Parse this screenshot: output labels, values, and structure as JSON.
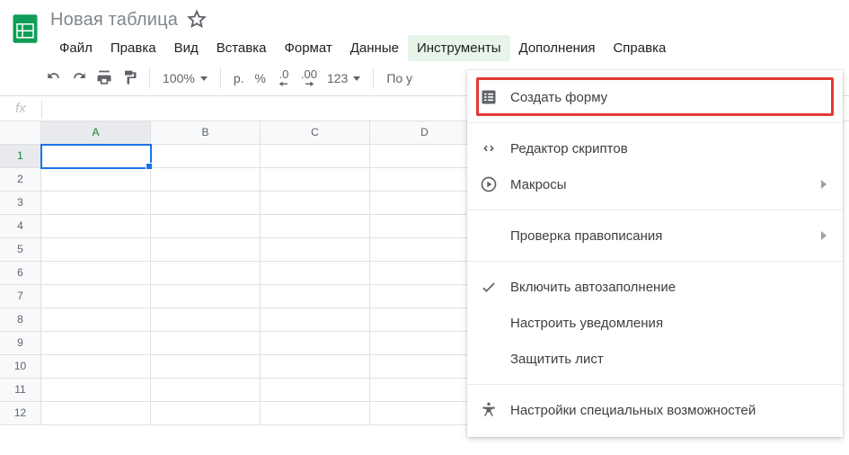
{
  "title": {
    "doc_name": "Новая таблица"
  },
  "menubar": {
    "items": [
      "Файл",
      "Правка",
      "Вид",
      "Вставка",
      "Формат",
      "Данные",
      "Инструменты",
      "Дополнения",
      "Справка"
    ],
    "active_index": 6
  },
  "toolbar": {
    "zoom": "100%",
    "currency_sign": "р.",
    "percent": "%",
    "dec_less": ".0",
    "dec_more": ".00",
    "format_123": "123",
    "font_truncated": "По у"
  },
  "formula_bar": {
    "label": "fx",
    "value": ""
  },
  "sheet": {
    "columns": [
      "A",
      "B",
      "C",
      "D"
    ],
    "selected_col_index": 0,
    "rows": [
      1,
      2,
      3,
      4,
      5,
      6,
      7,
      8,
      9,
      10,
      11,
      12
    ],
    "selected_row_index": 0
  },
  "dropdown": {
    "items": [
      {
        "icon": "form-icon",
        "label": "Создать форму",
        "submenu": false,
        "highlighted": true
      },
      {
        "sep": true
      },
      {
        "icon": "code-icon",
        "label": "Редактор скриптов",
        "submenu": false
      },
      {
        "icon": "play-circle-icon",
        "label": "Макросы",
        "submenu": true
      },
      {
        "sep": true
      },
      {
        "icon": "",
        "label": "Проверка правописания",
        "submenu": true
      },
      {
        "sep": true
      },
      {
        "icon": "check-icon",
        "label": "Включить автозаполнение",
        "submenu": false
      },
      {
        "icon": "",
        "label": "Настроить уведомления",
        "submenu": false
      },
      {
        "icon": "",
        "label": "Защитить лист",
        "submenu": false
      },
      {
        "sep": true
      },
      {
        "icon": "accessibility-icon",
        "label": "Настройки специальных возможностей",
        "submenu": false
      }
    ]
  }
}
